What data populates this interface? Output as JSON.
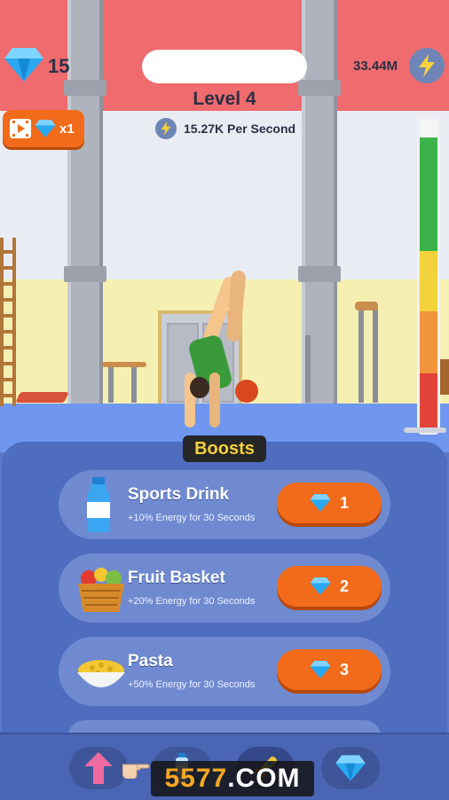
{
  "hud": {
    "gems": "15",
    "energy_total": "33.44M",
    "level": "Level 4",
    "rate": "15.27K Per Second",
    "ad_multiplier": "x1",
    "energy_meter_level": 0.9
  },
  "boosts": {
    "title": "Boosts",
    "items": [
      {
        "name": "Sports Drink",
        "desc": "+10% Energy for 30 Seconds",
        "price": "1",
        "icon": "water-bottle-icon"
      },
      {
        "name": "Fruit Basket",
        "desc": "+20% Energy for 30 Seconds",
        "price": "2",
        "icon": "fruit-basket-icon"
      },
      {
        "name": "Pasta",
        "desc": "+50% Energy for 30 Seconds",
        "price": "3",
        "icon": "pasta-bowl-icon"
      }
    ]
  },
  "nav": {
    "items": [
      "upgrade-arrow-icon",
      "boost-bottle-icon",
      "rocket-icon",
      "gem-shop-icon"
    ]
  },
  "watermark": {
    "brand": "5577",
    "suffix": ".COM"
  },
  "colors": {
    "accent_orange": "#f26b1a",
    "panel_blue": "#4f6dbf",
    "card_blue": "#6f8ad0",
    "title_yellow": "#f6d13c"
  }
}
